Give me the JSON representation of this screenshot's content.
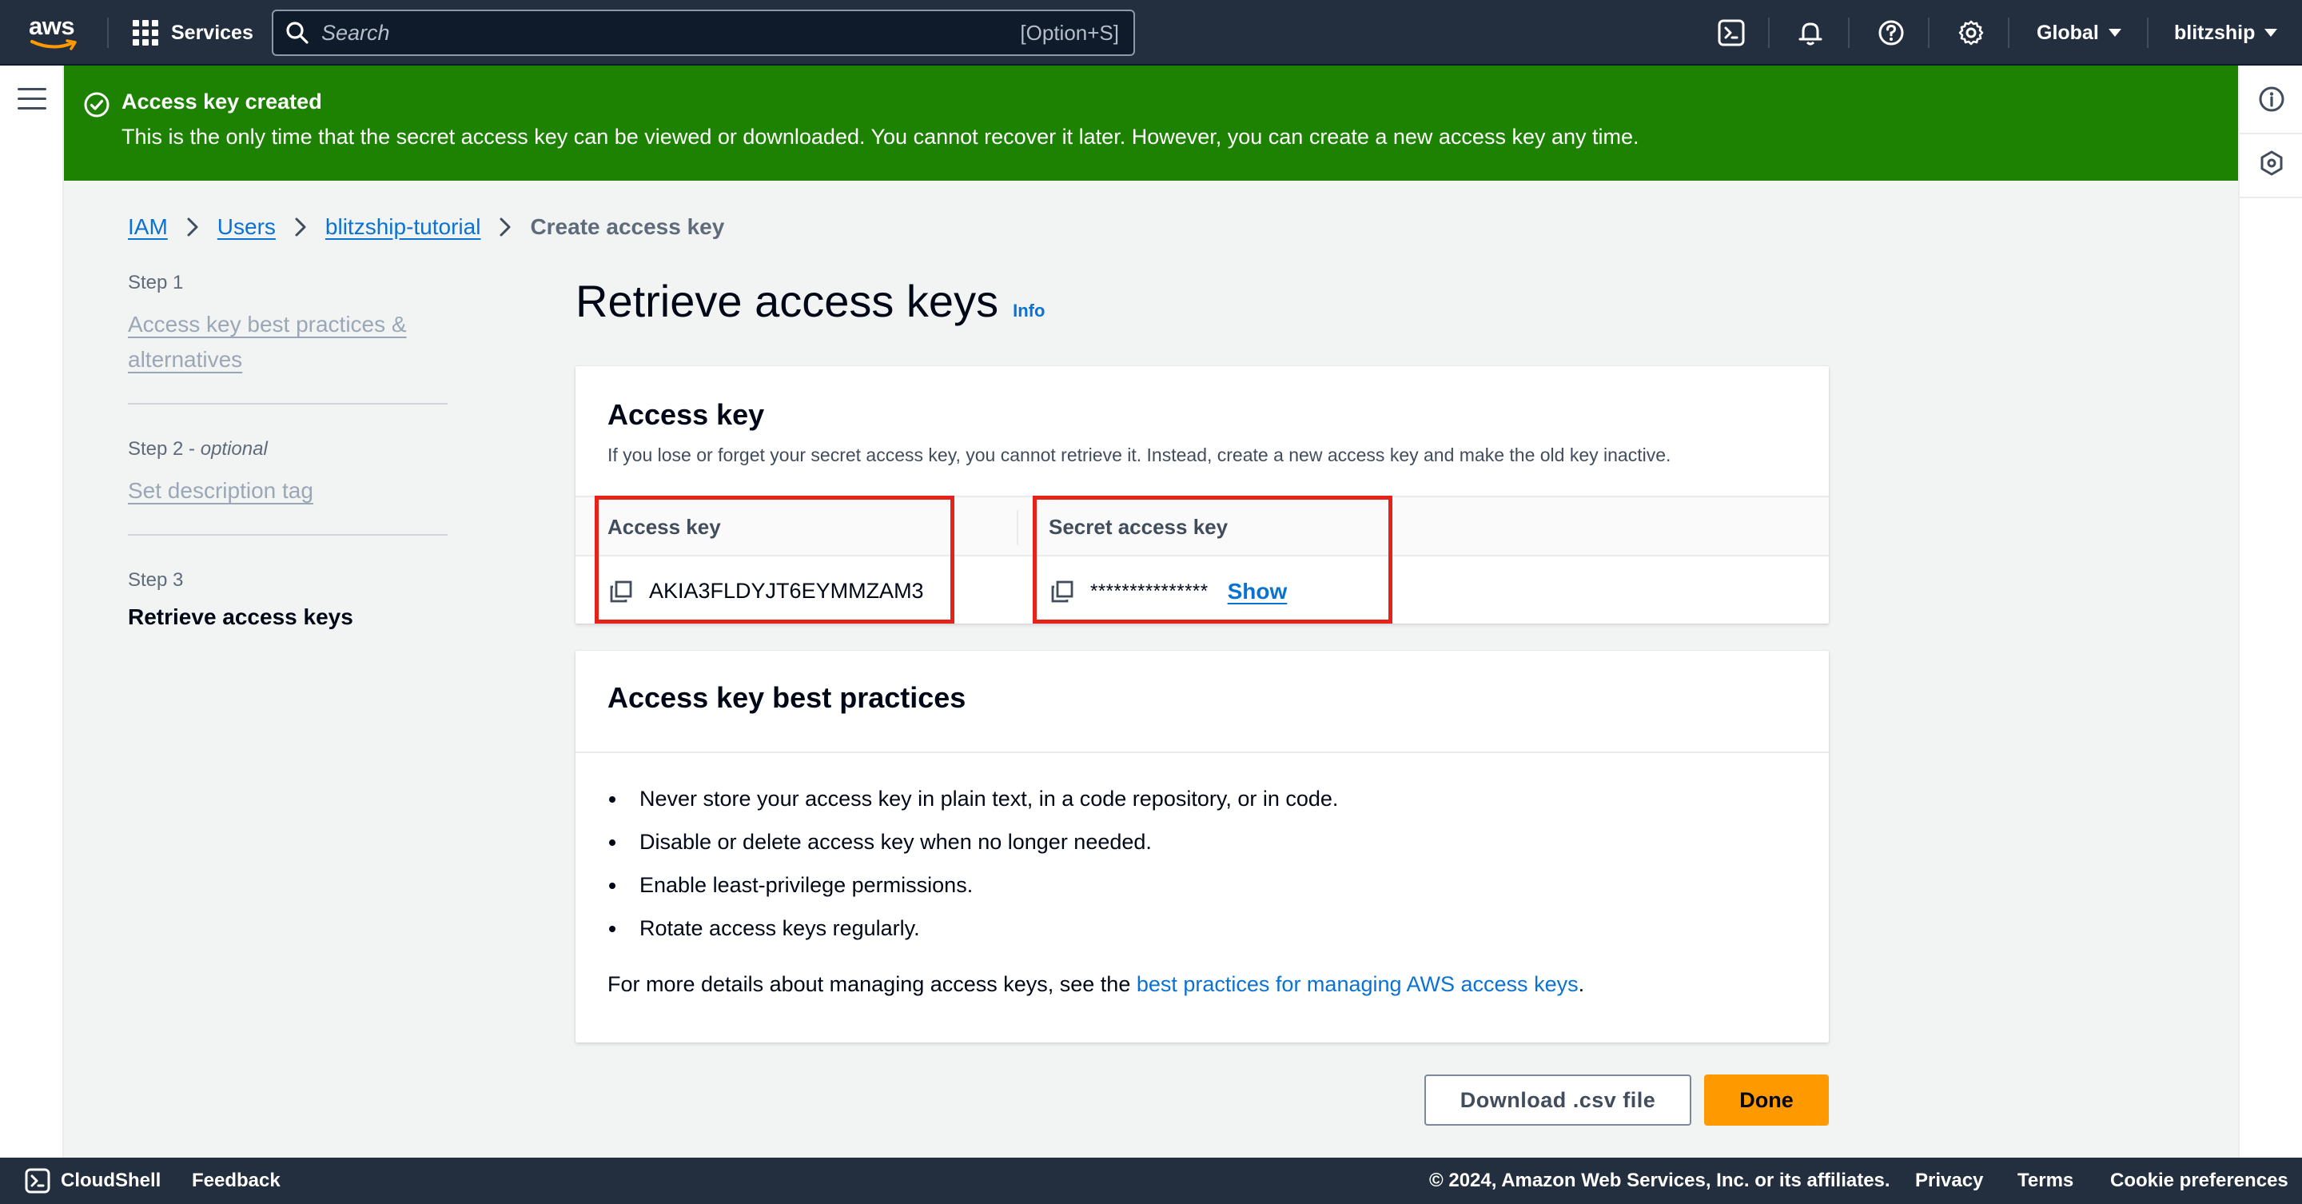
{
  "topnav": {
    "logo_text": "aws",
    "services_label": "Services",
    "search_placeholder": "Search",
    "search_shortcut": "[Option+S]",
    "region_label": "Global",
    "account_label": "blitzship"
  },
  "flash": {
    "title": "Access key created",
    "message": "This is the only time that the secret access key can be viewed or downloaded. You cannot recover it later. However, you can create a new access key any time.",
    "color": "#1d8102"
  },
  "breadcrumb": {
    "items": [
      "IAM",
      "Users",
      "blitzship-tutorial"
    ],
    "current": "Create access key"
  },
  "steps": [
    {
      "label": "Step 1",
      "optional": "",
      "title": "Access key best practices & alternatives",
      "state": "completed"
    },
    {
      "label": "Step 2",
      "optional": "optional",
      "title": "Set description tag",
      "state": "completed"
    },
    {
      "label": "Step 3",
      "optional": "",
      "title": "Retrieve access keys",
      "state": "active"
    }
  ],
  "page": {
    "title": "Retrieve access keys",
    "info_label": "Info"
  },
  "access_key_card": {
    "title": "Access key",
    "description": "If you lose or forget your secret access key, you cannot retrieve it. Instead, create a new access key and make the old key inactive.",
    "columns": [
      "Access key",
      "Secret access key"
    ],
    "access_key_value": "AKIA3FLDYJT6EYMMZAM3",
    "secret_value": "***************",
    "show_label": "Show"
  },
  "best_practices_card": {
    "title": "Access key best practices",
    "items": [
      "Never store your access key in plain text, in a code repository, or in code.",
      "Disable or delete access key when no longer needed.",
      "Enable least-privilege permissions.",
      "Rotate access keys regularly."
    ],
    "more_prefix": "For more details about managing access keys, see the ",
    "more_link": "best practices for managing AWS access keys",
    "more_suffix": "."
  },
  "actions": {
    "download_label": "Download .csv file",
    "done_label": "Done"
  },
  "footer": {
    "cloudshell_label": "CloudShell",
    "feedback_label": "Feedback",
    "copyright": "© 2024, Amazon Web Services, Inc. or its affiliates.",
    "privacy_label": "Privacy",
    "terms_label": "Terms",
    "cookie_label": "Cookie preferences"
  },
  "icons": {
    "nav": [
      "cloudshell-icon",
      "bell-icon",
      "help-icon",
      "settings-icon"
    ],
    "rail": [
      "info-icon",
      "hexagon-icon"
    ]
  },
  "colors": {
    "nav_bg": "#232f3e",
    "link": "#0972d3",
    "primary_button": "#ff9900",
    "highlight_box": "#e5231a"
  }
}
